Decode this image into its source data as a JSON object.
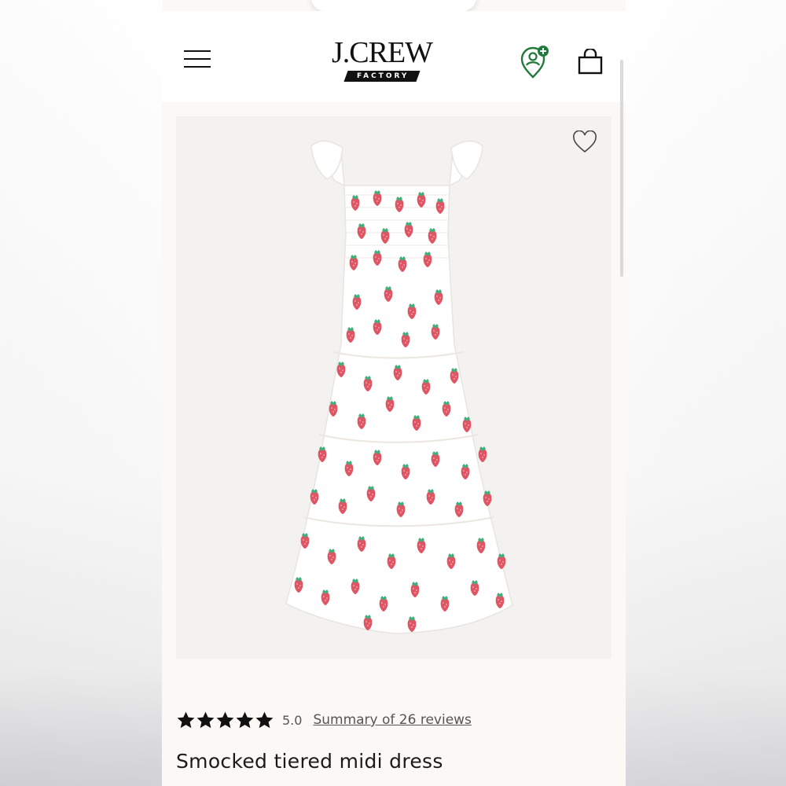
{
  "brand": {
    "logo_main": "J.CREW",
    "logo_sub": "FACTORY"
  },
  "icons": {
    "menu": "hamburger-menu-icon",
    "profile": "profile-location-icon",
    "bag": "shopping-bag-icon",
    "wishlist": "heart-outline-icon",
    "star": "star-filled-icon"
  },
  "colors": {
    "accent_green": "#1f7a3c",
    "text_dark": "#1a1a1a",
    "strawberry_red": "#e05563",
    "leaf_green": "#3fae7a"
  },
  "product": {
    "image_alt": "Smocked tiered midi dress with strawberry print",
    "rating_stars": 5,
    "rating_value": "5.0",
    "review_link": "Summary of 26 reviews",
    "title": "Smocked tiered midi dress"
  }
}
